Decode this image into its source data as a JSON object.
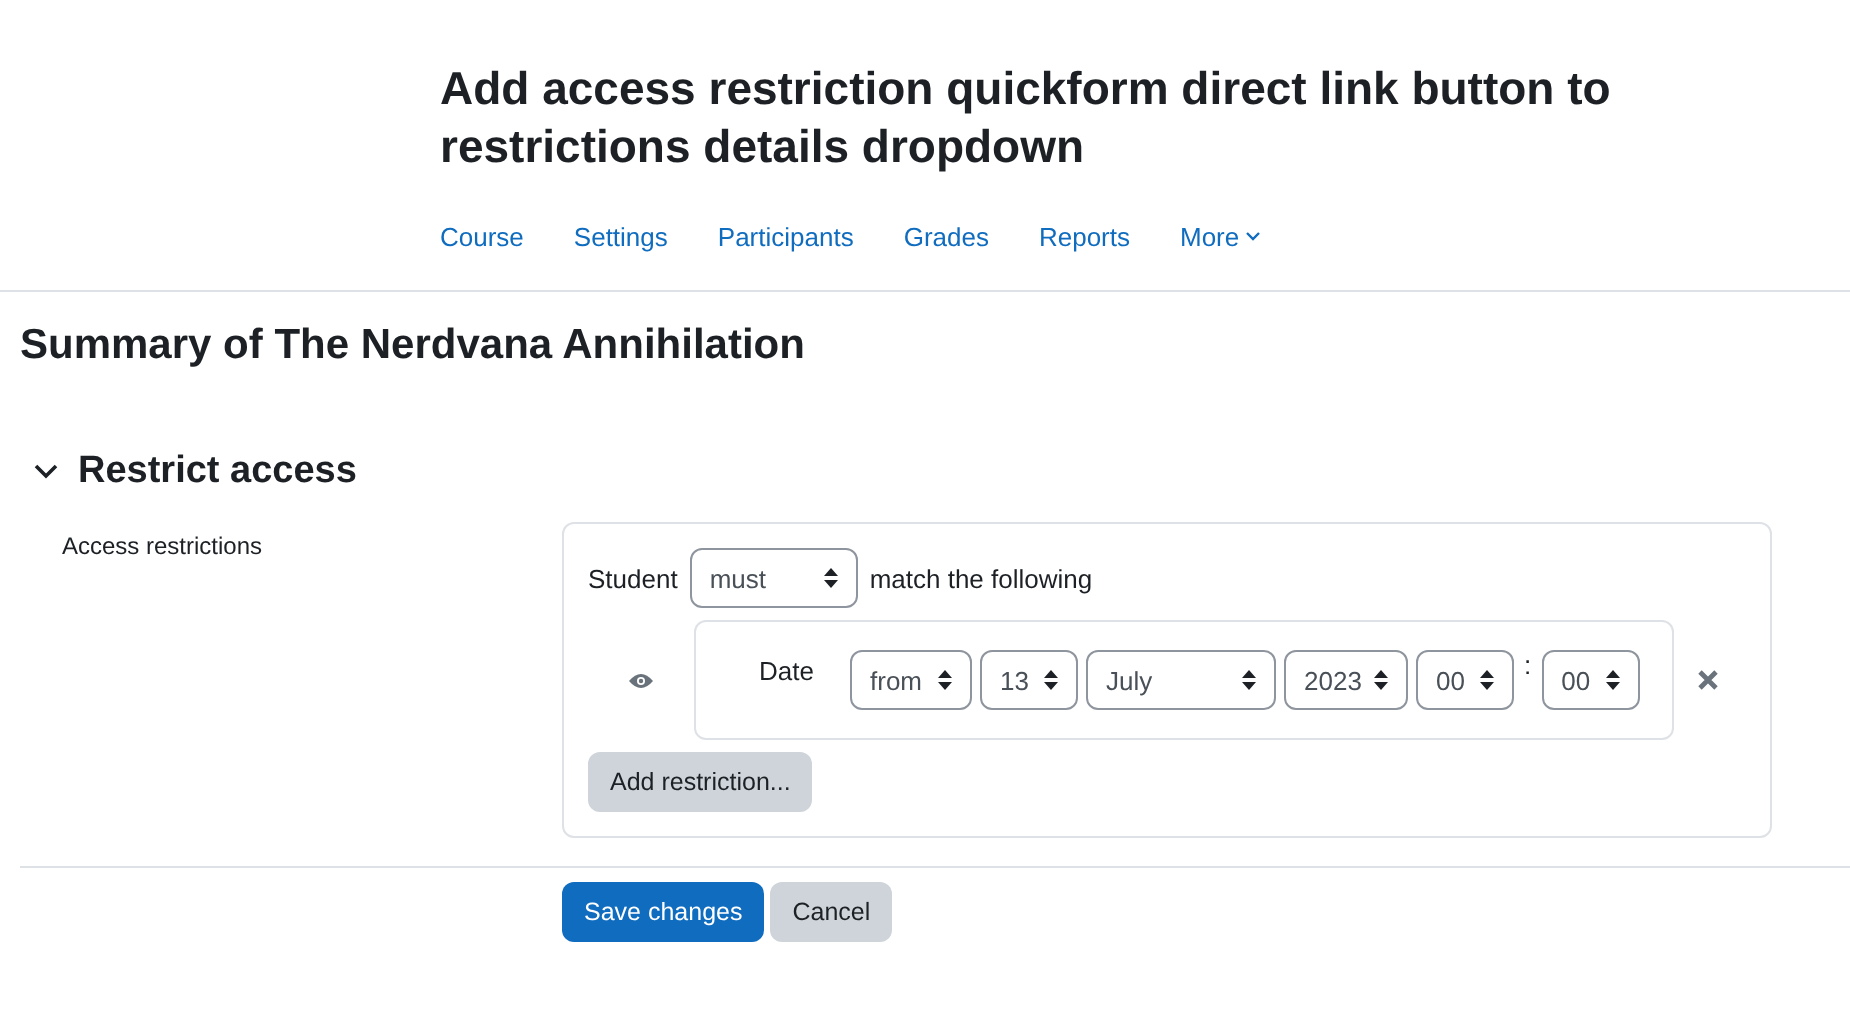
{
  "page_title": "Add access restriction quickform direct link button to restrictions details dropdown",
  "nav": [
    {
      "label": "Course",
      "kind": "link"
    },
    {
      "label": "Settings",
      "kind": "link"
    },
    {
      "label": "Participants",
      "kind": "link"
    },
    {
      "label": "Grades",
      "kind": "link"
    },
    {
      "label": "Reports",
      "kind": "link"
    },
    {
      "label": "More",
      "kind": "menu"
    }
  ],
  "heading": "Summary of The Nerdvana Annihilation",
  "section": {
    "title": "Restrict access",
    "expanded": true,
    "field_label": "Access restrictions",
    "match": {
      "prefix": "Student",
      "value": "must",
      "suffix": "match the following"
    },
    "restriction": {
      "label": "Date",
      "selects": [
        {
          "value": "from"
        },
        {
          "value": "13"
        },
        {
          "value": "July"
        },
        {
          "value": "2023"
        },
        {
          "value": "00"
        },
        {
          "value": "00"
        }
      ],
      "separator": ":"
    },
    "add_button": "Add restriction..."
  },
  "buttons": [
    {
      "label": "Save changes",
      "kind": "primary"
    },
    {
      "label": "Cancel",
      "kind": "secondary"
    }
  ]
}
